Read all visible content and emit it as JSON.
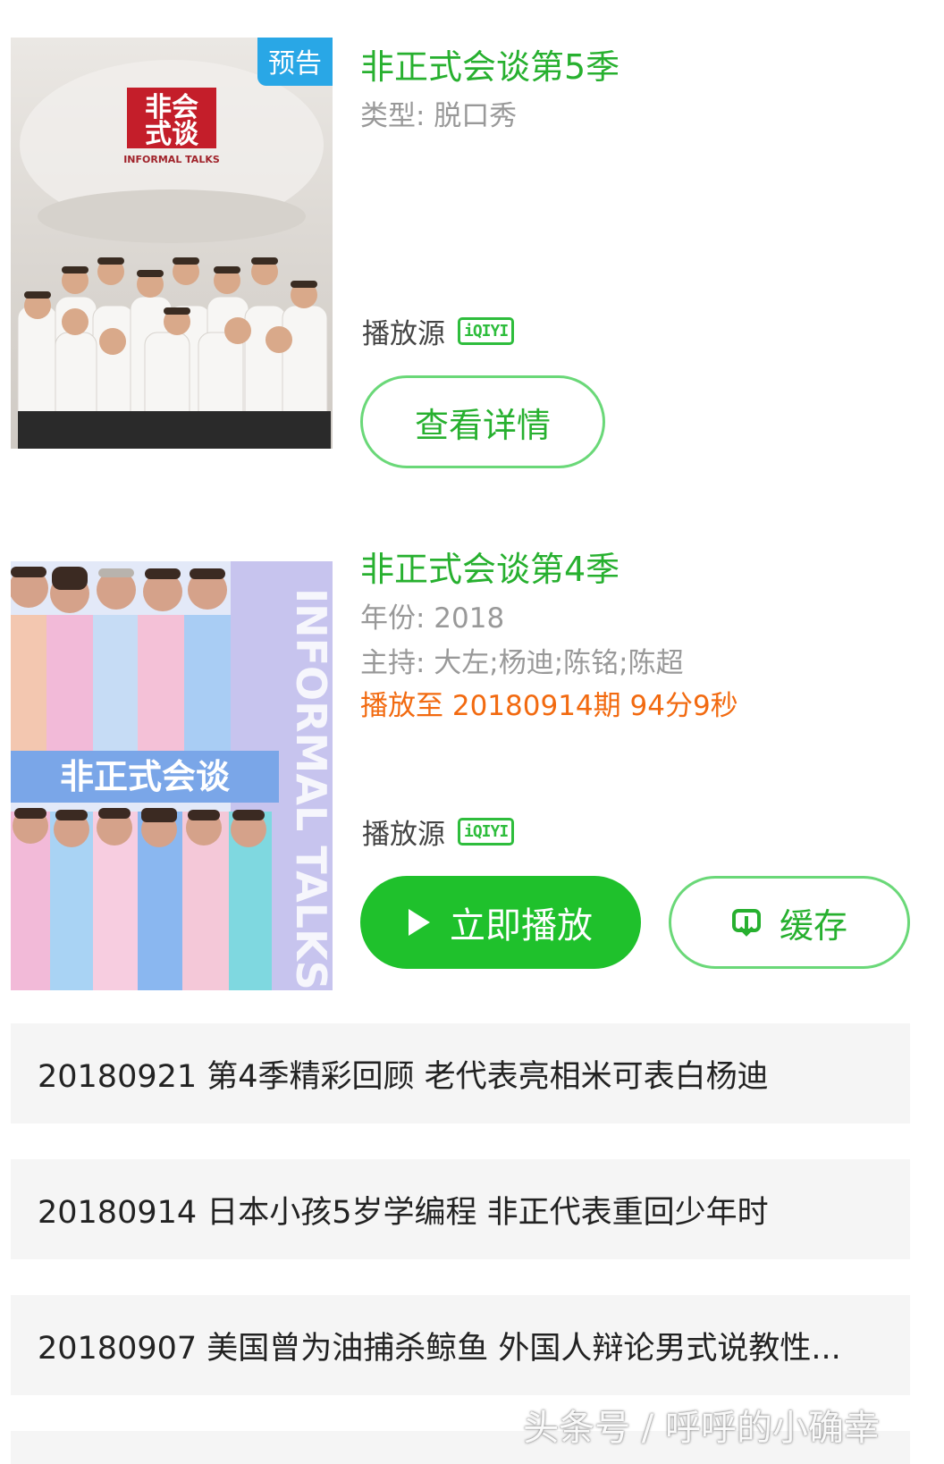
{
  "results": [
    {
      "badge": "预告",
      "title": "非正式会谈第5季",
      "genre": "类型: 脱口秀",
      "source_label": "播放源",
      "source_icon": "iqiyi-icon",
      "source_icon_text": "iQIYI",
      "detail_button": "查看详情",
      "poster_logo_line1": "非会",
      "poster_logo_line2": "式谈",
      "poster_brand": "INFORMAL TALKS"
    },
    {
      "title": "非正式会谈第4季",
      "year": "年份: 2018",
      "host": "主持: 大左;杨迪;陈铭;陈超",
      "progress": "播放至 20180914期 94分9秒",
      "source_label": "播放源",
      "source_icon": "iqiyi-icon",
      "source_icon_text": "iQIYI",
      "play_button": "立即播放",
      "cache_button": "缓存",
      "poster_banner": "非正式会谈",
      "poster_side_text": "INFORMAL TALKS"
    }
  ],
  "episodes": [
    "20180921 第4季精彩回顾 老代表亮相米可表白杨迪",
    "20180914 日本小孩5岁学编程 非正代表重回少年时",
    "20180907 美国曾为油捕杀鲸鱼 外国人辩论男式说教性..."
  ],
  "watermark": "头条号 / 呼呼的小确幸",
  "colors": {
    "accent_green": "#1fc12c",
    "title_green": "#27b02f",
    "progress_orange": "#f26a10",
    "badge_blue": "#29a7e6"
  }
}
